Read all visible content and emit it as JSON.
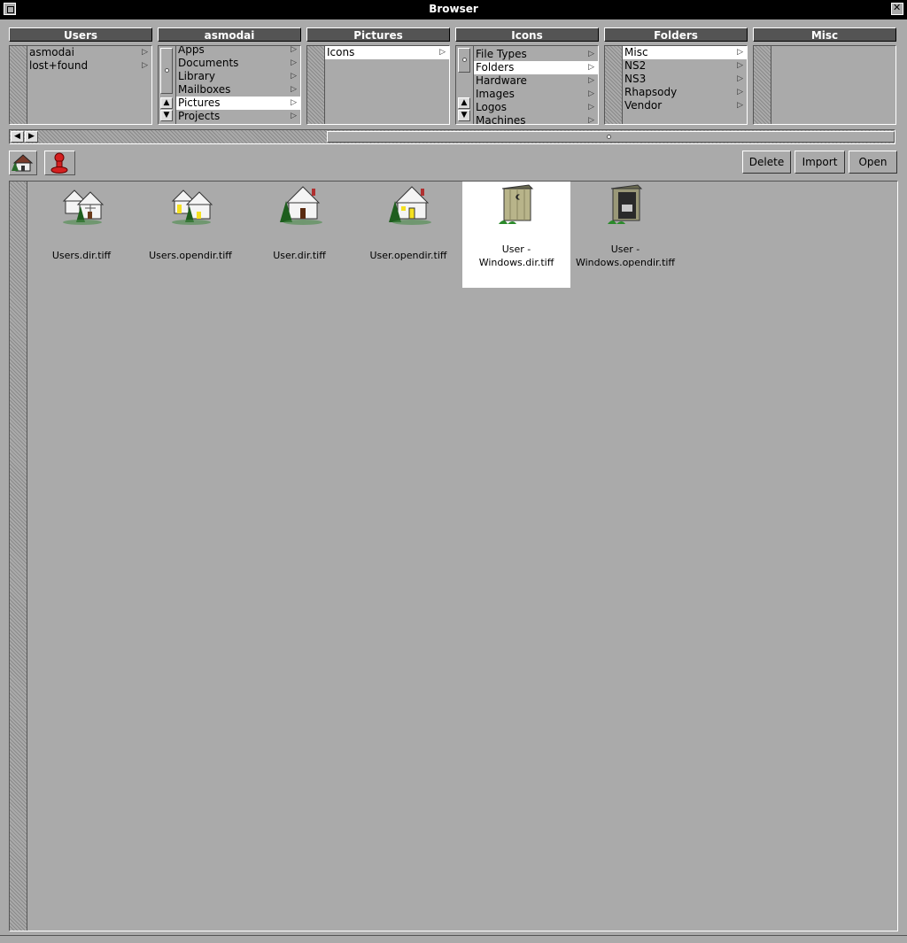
{
  "window": {
    "title": "Browser"
  },
  "columns": [
    {
      "title": "Users",
      "items": [
        {
          "label": "asmodai",
          "selected": true
        },
        {
          "label": "lost+found",
          "selected": false
        }
      ]
    },
    {
      "title": "asmodai",
      "items": [
        {
          "label": "Apps",
          "selected": false
        },
        {
          "label": "Documents",
          "selected": false
        },
        {
          "label": "Library",
          "selected": false
        },
        {
          "label": "Mailboxes",
          "selected": false
        },
        {
          "label": "Pictures",
          "selected": true
        },
        {
          "label": "Projects",
          "selected": false
        }
      ]
    },
    {
      "title": "Pictures",
      "items": [
        {
          "label": "Icons",
          "selected": true
        }
      ]
    },
    {
      "title": "Icons",
      "items": [
        {
          "label": "File Types",
          "selected": false
        },
        {
          "label": "Folders",
          "selected": true
        },
        {
          "label": "Hardware",
          "selected": false
        },
        {
          "label": "Images",
          "selected": false
        },
        {
          "label": "Logos",
          "selected": false
        },
        {
          "label": "Machines",
          "selected": false
        }
      ]
    },
    {
      "title": "Folders",
      "items": [
        {
          "label": "Misc",
          "selected": true
        },
        {
          "label": "NS2",
          "selected": false
        },
        {
          "label": "NS3",
          "selected": false
        },
        {
          "label": "Rhapsody",
          "selected": false
        },
        {
          "label": "Vendor",
          "selected": false
        }
      ]
    },
    {
      "title": "Misc",
      "items": []
    }
  ],
  "toolbar": {
    "delete_label": "Delete",
    "import_label": "Import",
    "open_label": "Open",
    "shelf": [
      "home-icon",
      "user-icon"
    ]
  },
  "files": [
    {
      "line1": "Users.dir.tiff",
      "line2": "",
      "icon": "houses-icon",
      "selected": false
    },
    {
      "line1": "Users.opendir.tiff",
      "line2": "",
      "icon": "houses-open-icon",
      "selected": false
    },
    {
      "line1": "User.dir.tiff",
      "line2": "",
      "icon": "house-icon",
      "selected": false
    },
    {
      "line1": "User.opendir.tiff",
      "line2": "",
      "icon": "house-open-icon",
      "selected": false
    },
    {
      "line1": "User -",
      "line2": "Windows.dir.tiff",
      "icon": "outhouse-icon",
      "selected": true
    },
    {
      "line1": "User -",
      "line2": "Windows.opendir.tiff",
      "icon": "outhouse-open-icon",
      "selected": false
    }
  ]
}
